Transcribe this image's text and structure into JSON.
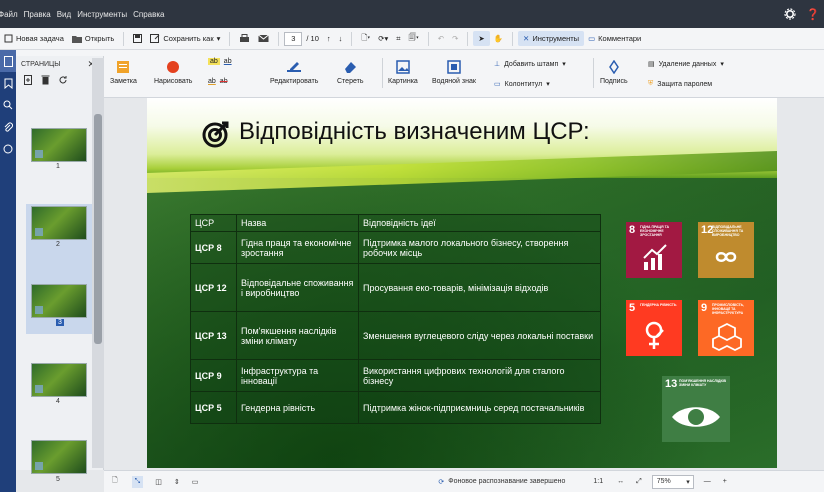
{
  "menubar": {
    "items": [
      "Файл",
      "Правка",
      "Вид",
      "Инструменты",
      "Справка"
    ]
  },
  "toolbar": {
    "new_task": "Новая задача",
    "open": "Открыть",
    "save_as": "Сохранить как",
    "page_current": "3",
    "page_total": "/ 10",
    "tools": "Инструменты",
    "comments": "Комментари"
  },
  "ribbon": {
    "note": "Заметка",
    "draw": "Нарисовать",
    "edit": "Редактировать",
    "erase": "Стереть",
    "picture": "Картинка",
    "watermark": "Водяной знак",
    "add_stamp": "Добавить штамп",
    "header_footer": "Колонтитул",
    "signature": "Подпись",
    "remove_data": "Удаление данных",
    "password_protect": "Защита паролем",
    "ab": "ab"
  },
  "pages_panel": {
    "title": "СТРАНИЦЫ",
    "thumbnails": [
      "1",
      "2",
      "3",
      "4",
      "5"
    ]
  },
  "slide": {
    "title": "Відповідність визначеним ЦСР:",
    "table": {
      "headers": [
        "ЦСР",
        "Назва",
        "Відповідність ідеї"
      ],
      "rows": [
        [
          "ЦСР 8",
          "Гідна праця та економічне зростання",
          "Підтримка малого локального бізнесу, створення робочих місць"
        ],
        [
          "ЦСР 12",
          "Відповідальне споживання і виробництво",
          "Просування еко-товарів, мінімізація відходів"
        ],
        [
          "ЦСР 13",
          "Пом'якшення наслідків зміни клімату",
          "Зменшення вуглецевого сліду через локальні поставки"
        ],
        [
          "ЦСР 9",
          "Інфраструктура та інновації",
          "Використання цифрових технологій для сталого бізнесу"
        ],
        [
          "ЦСР 5",
          "Гендерна рівність",
          "Підтримка жінок-підприємниць серед постачальників"
        ]
      ]
    },
    "sdg_cards": [
      {
        "num": "8",
        "text": "ГІДНА ПРАЦЯ ТА ЕКОНОМІЧНЕ ЗРОСТАННЯ",
        "color": "#a21942"
      },
      {
        "num": "12",
        "text": "ВІДПОВІДАЛЬНЕ СПОЖИВАННЯ ТА ВИРОБНИЦТВО",
        "color": "#bf8b2e"
      },
      {
        "num": "5",
        "text": "ГЕНДЕРНА РІВНІСТЬ",
        "color": "#ff3a21"
      },
      {
        "num": "9",
        "text": "ПРОМИСЛОВІСТЬ, ІННОВАЦІЇ ТА ІНФРАСТРУКТУРА",
        "color": "#fd6925"
      },
      {
        "num": "13",
        "text": "ПОМ'ЯКШЕННЯ НАСЛІДКІВ ЗМІНИ КЛІМАТУ",
        "color": "#3f7e44"
      }
    ]
  },
  "statusbar": {
    "ocr_status": "Фоновое распознавание завершено",
    "ratio": "1:1",
    "zoom": "75%"
  }
}
